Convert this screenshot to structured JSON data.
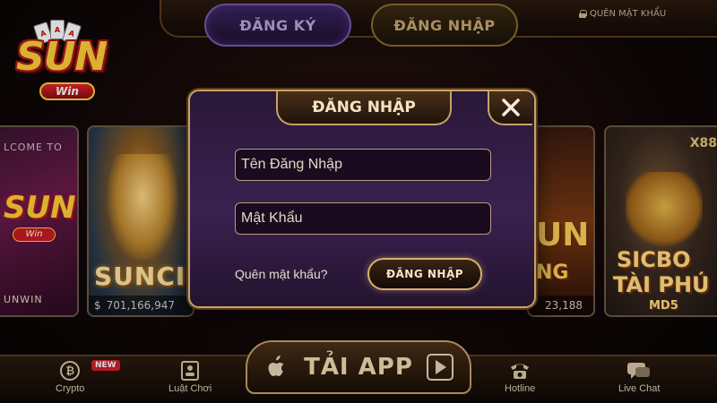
{
  "header": {
    "register_tab": "ĐĂNG KÝ",
    "login_tab": "ĐĂNG NHẬP",
    "forgot_password": "QUÊN MẬT KHẨU"
  },
  "logo": {
    "brand": "SUN",
    "ribbon": "Win"
  },
  "games": {
    "welcome": {
      "top_text": "LCOME TO",
      "brand": "SUN",
      "ribbon": "Win",
      "bottom_text": "UNWIN"
    },
    "suncity": {
      "title": "SUNCI",
      "jackpot_symbol": "$",
      "jackpot": "701,166,947"
    },
    "sun3": {
      "title": "UN",
      "subtitle": "NG",
      "jackpot": "23,188"
    },
    "sicbo": {
      "multiplier": "X88",
      "line1": "SICBO",
      "line2": "TÀI PHÚ",
      "line3": "MD5"
    }
  },
  "login_dialog": {
    "title": "ĐĂNG NHẬP",
    "username_placeholder": "Tên Đăng Nhập",
    "password_placeholder": "Mật Khẩu",
    "forgot_link": "Quên mật khẩu?",
    "submit_label": "ĐĂNG NHẬP"
  },
  "bottom_nav": {
    "crypto": "Crypto",
    "crypto_badge": "NEW",
    "rules": "Luật Chơi",
    "download": "TẢI APP",
    "hotline": "Hotline",
    "live_chat": "Live Chat"
  },
  "colors": {
    "gold_border": "#c6a26a",
    "dialog_bg": "#3a2150",
    "register_purple": "#7a5aa8",
    "badge_red": "#d0202a"
  }
}
